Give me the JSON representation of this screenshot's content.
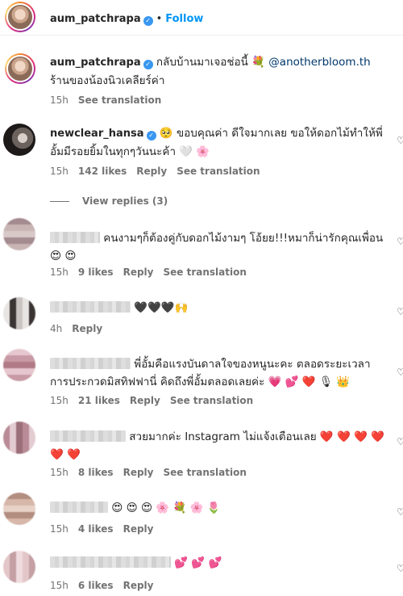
{
  "header": {
    "username": "aum_patchrapa",
    "separator": "•",
    "follow_label": "Follow"
  },
  "caption": {
    "username": "aum_patchrapa",
    "text_before": " กลับบ้านมาเจอช่อนี้ 💐 ",
    "mention": "@anotherbloom.th",
    "text_after": " ร้านของน้องนิวเคลียร์ค่า",
    "time": "15h",
    "see_translation": "See translation"
  },
  "comments": [
    {
      "username": "newclear_hansa",
      "text": " 🥺 ขอบคุณค่า ดีใจมากเลย ขอให้ดอกไม้ทำให้พี่อั้มมีรอยยิ้มในทุกๆวันนะค้า 🤍 🌸",
      "time": "15h",
      "likes": "142 likes",
      "reply": "Reply",
      "see_translation": "See translation",
      "view_replies": "View replies (3)"
    },
    {
      "text": "คนงามๆก็ต้องคู่กับดอกไม้งามๆ โอ้ยย!!!หมาก็น่ารักคุณเพื่อน 😍 😍",
      "time": "15h",
      "likes": "9 likes",
      "reply": "Reply",
      "see_translation": "See translation"
    },
    {
      "text": "🖤🖤🖤🙌",
      "time": "4h",
      "reply": "Reply"
    },
    {
      "text": "พี่อั้มคือแรงบันดาลใจของหนูนะคะ ตลอดระยะเวลาการประกวดมิสทิฟฟานี่ คิดถึงพี่อั้มตลอดเลยค่ะ 💗 💕 ❤️ 🎙 👑",
      "time": "15h",
      "likes": "21 likes",
      "reply": "Reply",
      "see_translation": "See translation"
    },
    {
      "text": "สวยมากค่ะ Instagram ไม่แจ้งเตือนเลย ❤️ ❤️ ❤️ ❤️ ❤️ ❤️",
      "time": "15h",
      "likes": "8 likes",
      "reply": "Reply",
      "see_translation": "See translation"
    },
    {
      "text": "😍 😍 😍 🌸 💐 🌸 🌷",
      "time": "15h",
      "likes": "4 likes",
      "reply": "Reply"
    },
    {
      "text": "💕 💕 💕",
      "time": "15h",
      "likes": "6 likes",
      "reply": "Reply"
    }
  ]
}
